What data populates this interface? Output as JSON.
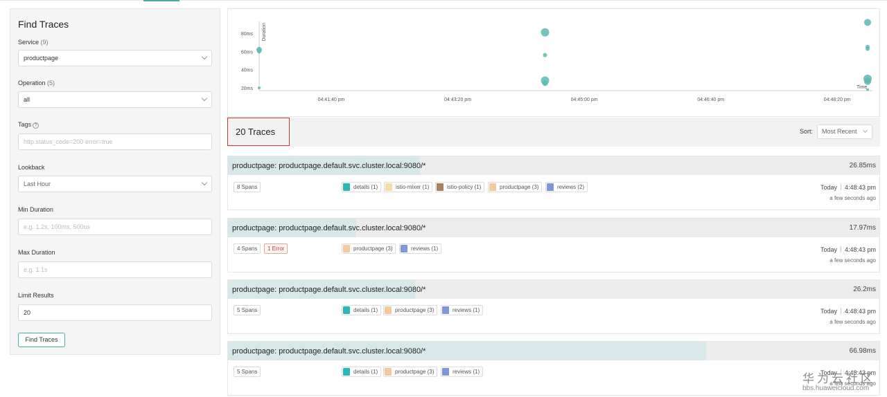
{
  "sidebar": {
    "title": "Find Traces",
    "service": {
      "label": "Service",
      "count": "(9)",
      "value": "productpage"
    },
    "operation": {
      "label": "Operation",
      "count": "(5)",
      "value": "all"
    },
    "tags": {
      "label": "Tags",
      "help": "?",
      "placeholder": "http.status_code=200 error=true"
    },
    "lookback": {
      "label": "Lookback",
      "value": "Last Hour"
    },
    "min_duration": {
      "label": "Min Duration",
      "placeholder": "e.g. 1.2s, 100ms, 500us"
    },
    "max_duration": {
      "label": "Max Duration",
      "placeholder": "e.g. 1.1s"
    },
    "limit": {
      "label": "Limit Results",
      "value": "20"
    },
    "find_button": "Find Traces"
  },
  "chart_data": {
    "type": "scatter",
    "ylabel": "Duration",
    "xlabel": "Time",
    "y_ticks": [
      "20ms",
      "40ms",
      "60ms",
      "80ms"
    ],
    "x_ticks": [
      "04:41:40 pm",
      "04:43:20 pm",
      "04:45:00 pm",
      "04:46:40 pm",
      "04:48:20 pm"
    ],
    "x_range": [
      "04:40:43 pm",
      "04:48:44 pm"
    ],
    "ylim": [
      17,
      93
    ],
    "grid": false,
    "points": [
      {
        "x": "04:40:43 pm",
        "y": 62,
        "size": 4
      },
      {
        "x": "04:40:43 pm",
        "y": 60,
        "size": 3
      },
      {
        "x": "04:40:43 pm",
        "y": 20,
        "size": 2
      },
      {
        "x": "04:44:29 pm",
        "y": 81,
        "size": 6
      },
      {
        "x": "04:44:29 pm",
        "y": 56,
        "size": 3
      },
      {
        "x": "04:44:29 pm",
        "y": 28,
        "size": 6
      },
      {
        "x": "04:44:29 pm",
        "y": 25,
        "size": 4
      },
      {
        "x": "04:48:44 pm",
        "y": 92,
        "size": 5
      },
      {
        "x": "04:48:44 pm",
        "y": 65,
        "size": 3
      },
      {
        "x": "04:48:44 pm",
        "y": 63,
        "size": 3
      },
      {
        "x": "04:48:44 pm",
        "y": 30,
        "size": 6
      },
      {
        "x": "04:48:44 pm",
        "y": 27,
        "size": 5
      },
      {
        "x": "04:48:44 pm",
        "y": 18,
        "size": 2
      }
    ]
  },
  "results": {
    "count_label": "20 Traces",
    "sort_label": "Sort:",
    "sort_value": "Most Recent"
  },
  "colors": {
    "details": "#2ab8b8",
    "istio-mixer": "#f5dda6",
    "istio-policy": "#a8845e",
    "productpage": "#f4c9a0",
    "reviews": "#7f97d8",
    "point": "#5bb8b3"
  },
  "traces": [
    {
      "title": "productpage: productpage.default.svc.cluster.local:9080/*",
      "duration": "26.85ms",
      "duration_ms": 26.85,
      "spans": "8 Spans",
      "errors": "",
      "services": [
        {
          "name": "details (1)",
          "color": "#2ab8b8"
        },
        {
          "name": "istio-mixer (1)",
          "color": "#f5dda6"
        },
        {
          "name": "istio-policy (1)",
          "color": "#a8845e"
        },
        {
          "name": "productpage (3)",
          "color": "#f4c9a0"
        },
        {
          "name": "reviews (2)",
          "color": "#7f97d8"
        }
      ],
      "date": "Today",
      "time": "4:48:43 pm",
      "ago": "a few seconds ago"
    },
    {
      "title": "productpage: productpage.default.svc.cluster.local:9080/*",
      "duration": "17.97ms",
      "duration_ms": 17.97,
      "spans": "4 Spans",
      "errors": "1 Error",
      "services": [
        {
          "name": "productpage (3)",
          "color": "#f4c9a0"
        },
        {
          "name": "reviews (1)",
          "color": "#7f97d8"
        }
      ],
      "date": "Today",
      "time": "4:48:43 pm",
      "ago": "a few seconds ago"
    },
    {
      "title": "productpage: productpage.default.svc.cluster.local:9080/*",
      "duration": "26.2ms",
      "duration_ms": 26.2,
      "spans": "5 Spans",
      "errors": "",
      "services": [
        {
          "name": "details (1)",
          "color": "#2ab8b8"
        },
        {
          "name": "productpage (3)",
          "color": "#f4c9a0"
        },
        {
          "name": "reviews (1)",
          "color": "#7f97d8"
        }
      ],
      "date": "Today",
      "time": "4:48:43 pm",
      "ago": "a few seconds ago"
    },
    {
      "title": "productpage: productpage.default.svc.cluster.local:9080/*",
      "duration": "66.98ms",
      "duration_ms": 66.98,
      "spans": "5 Spans",
      "errors": "",
      "services": [
        {
          "name": "details (1)",
          "color": "#2ab8b8"
        },
        {
          "name": "productpage (3)",
          "color": "#f4c9a0"
        },
        {
          "name": "reviews (1)",
          "color": "#7f97d8"
        }
      ],
      "date": "Today",
      "time": "4:48:43 pm",
      "ago": "a few seconds ago"
    }
  ],
  "watermark": {
    "cn": "华为云社区",
    "url": "bbs.huaweicloud.com"
  }
}
